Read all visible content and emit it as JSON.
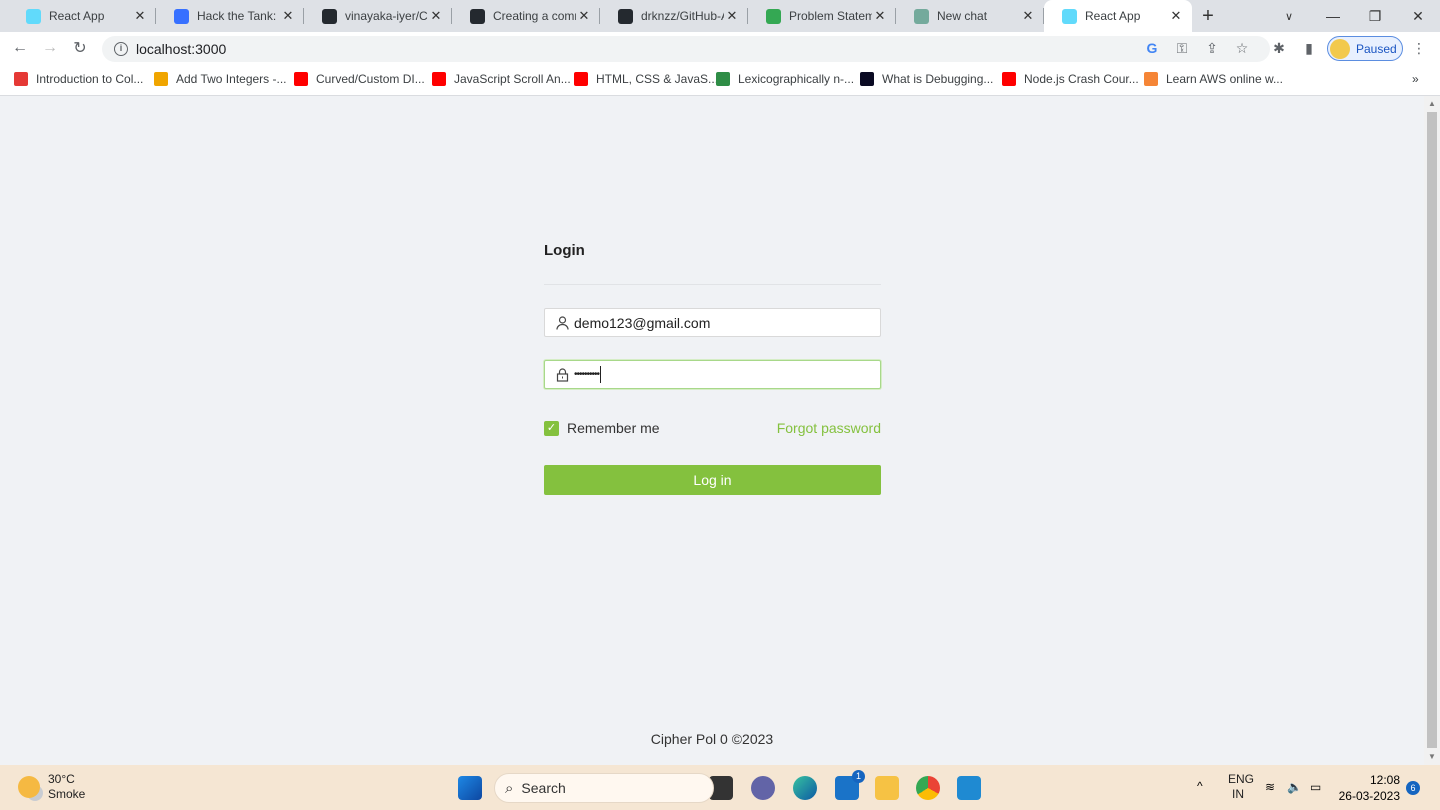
{
  "browser": {
    "tabs": [
      {
        "title": "React App",
        "icon": "react-icon",
        "color": "#61dafb"
      },
      {
        "title": "Hack the Tank: Da",
        "icon": "devfolio-icon",
        "color": "#3770ff"
      },
      {
        "title": "vinayaka-iyer/Cip",
        "icon": "github-icon",
        "color": "#24292f"
      },
      {
        "title": "Creating a comm",
        "icon": "github-icon",
        "color": "#24292f"
      },
      {
        "title": "drknzz/GitHub-A",
        "icon": "github-icon",
        "color": "#24292f"
      },
      {
        "title": "Problem Stateme",
        "icon": "google-drive-icon",
        "color": "#34a853"
      },
      {
        "title": "New chat",
        "icon": "chatgpt-icon",
        "color": "#74aa9c"
      },
      {
        "title": "React App",
        "icon": "react-icon",
        "color": "#61dafb",
        "active": true
      }
    ],
    "url": "localhost:3000",
    "profile_label": "Paused",
    "bookmarks": [
      {
        "title": "Introduction to Col...",
        "icon": "bookmark-icon",
        "color": "#e53935"
      },
      {
        "title": "Add Two Integers -...",
        "icon": "leetcode-icon",
        "color": "#f0a500"
      },
      {
        "title": "Curved/Custom DI...",
        "icon": "youtube-icon",
        "color": "#ff0000"
      },
      {
        "title": "JavaScript Scroll An...",
        "icon": "youtube-icon",
        "color": "#ff0000"
      },
      {
        "title": "HTML, CSS & JavaS...",
        "icon": "youtube-icon",
        "color": "#ff0000"
      },
      {
        "title": "Lexicographically n-...",
        "icon": "geeksforgeeks-icon",
        "color": "#2f8d46"
      },
      {
        "title": "What is Debugging...",
        "icon": "freecodecamp-icon",
        "color": "#0a0a23"
      },
      {
        "title": "Node.js Crash Cour...",
        "icon": "youtube-icon",
        "color": "#ff0000"
      },
      {
        "title": "Learn AWS online w...",
        "icon": "aws-icon",
        "color": "#f58536"
      }
    ],
    "more_bookmarks": "»"
  },
  "login": {
    "title": "Login",
    "email_value": "demo123@gmail.com",
    "password_value": "••••••••••",
    "remember_label": "Remember me",
    "remember_checked": true,
    "forgot_label": "Forgot password",
    "submit_label": "Log in",
    "accent": "#84c13e"
  },
  "footer": "Cipher Pol 0 ©2023",
  "taskbar": {
    "temperature": "30°C",
    "weather": "Smoke",
    "search_label": "Search",
    "mail_badge": "1",
    "lang_top": "ENG",
    "lang_bottom": "IN",
    "time": "12:08",
    "date": "26-03-2023",
    "notifications": "6"
  }
}
